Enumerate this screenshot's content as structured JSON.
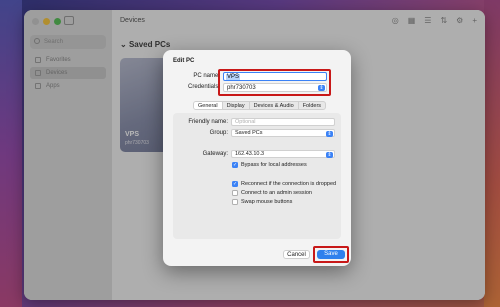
{
  "window": {
    "title": "Devices"
  },
  "sidebar": {
    "search_placeholder": "Search",
    "items": [
      {
        "label": "Favorites"
      },
      {
        "label": "Devices"
      },
      {
        "label": "Apps"
      }
    ]
  },
  "main": {
    "section_title": "Saved PCs",
    "pc_card": {
      "name": "VPS",
      "user": "phr730703"
    }
  },
  "dialog": {
    "title": "Edit PC",
    "pc_name_label": "PC name:",
    "pc_name_value": "VPS",
    "credentials_label": "Credentials:",
    "credentials_value": "phr730703",
    "tabs": [
      "General",
      "Display",
      "Devices & Audio",
      "Folders"
    ],
    "friendly_name_label": "Friendly name:",
    "friendly_name_placeholder": "Optional",
    "group_label": "Group:",
    "group_value": "Saved PCs",
    "gateway_label": "Gateway:",
    "gateway_value": "162.43.10.3",
    "bypass_label": "Bypass for local addresses",
    "reconnect_label": "Reconnect if the connection is dropped",
    "admin_label": "Connect to an admin session",
    "swap_label": "Swap mouse buttons",
    "cancel_label": "Cancel",
    "save_label": "Save"
  },
  "colors": {
    "accent": "#2f80ed",
    "highlight": "#c81818"
  }
}
